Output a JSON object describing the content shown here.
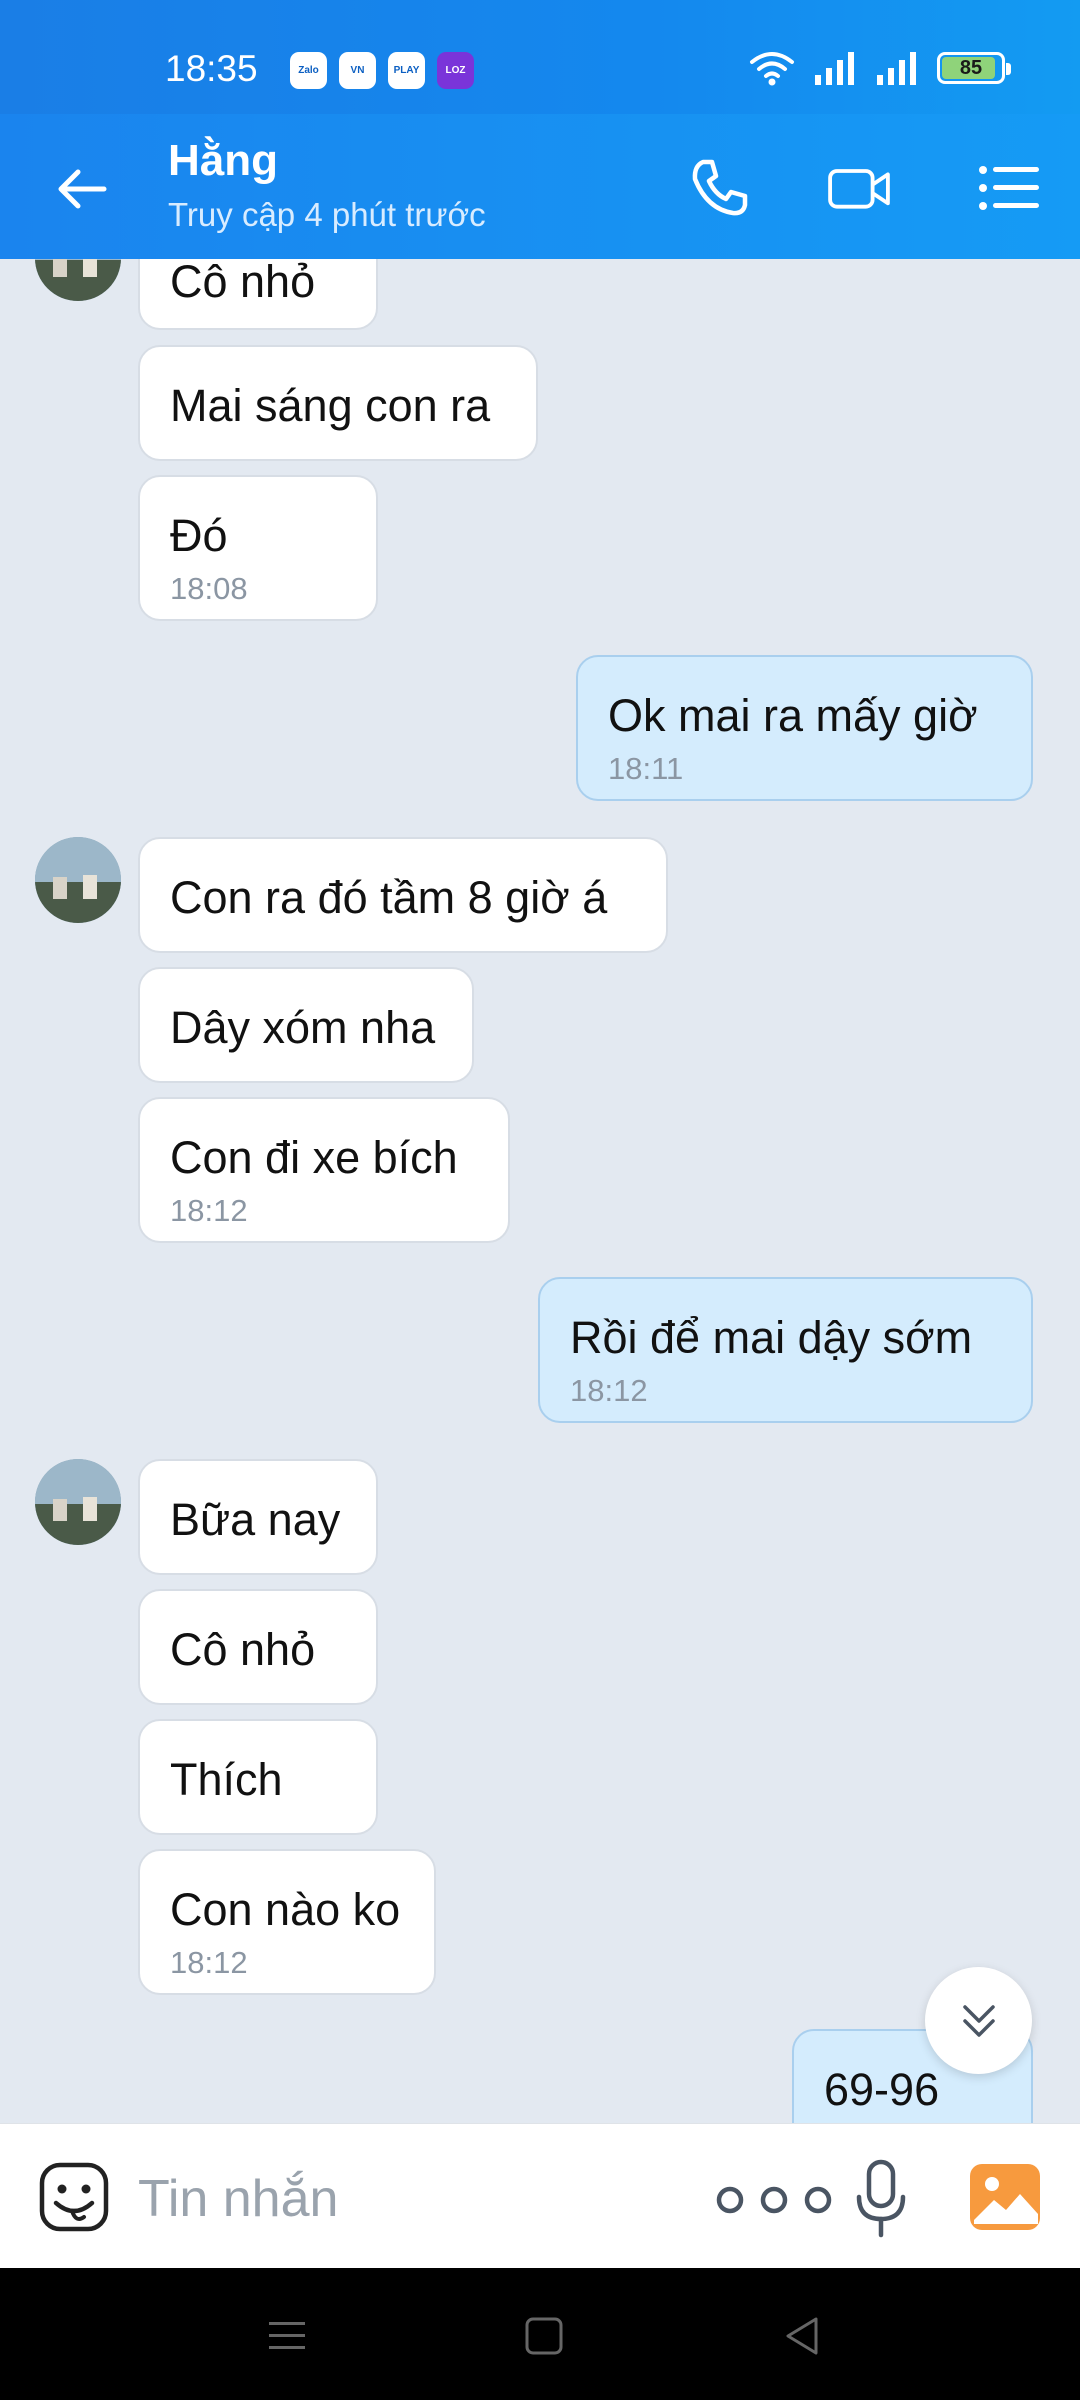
{
  "status_bar": {
    "time": "18:35",
    "apps": [
      "Zalo",
      "VN",
      "PLAY",
      "LOZ"
    ],
    "battery": "85"
  },
  "header": {
    "name": "Hằng",
    "status": "Truy cập 4 phút trước"
  },
  "messages": [
    {
      "text": "Cô nhỏ",
      "time": ""
    },
    {
      "text": "Mai sáng con ra",
      "time": ""
    },
    {
      "text": "Đó",
      "time": "18:08"
    },
    {
      "text": "Ok mai ra mấy giờ",
      "time": "18:11"
    },
    {
      "text": "Con ra đó tầm 8 giờ á",
      "time": ""
    },
    {
      "text": "Dây xóm nha",
      "time": ""
    },
    {
      "text": "Con đi xe bích",
      "time": "18:12"
    },
    {
      "text": "Rồi để mai dậy sớm",
      "time": "18:12"
    },
    {
      "text": "Bữa nay",
      "time": ""
    },
    {
      "text": "Cô nhỏ",
      "time": ""
    },
    {
      "text": "Thích",
      "time": ""
    },
    {
      "text": "Con nào ko",
      "time": "18:12"
    },
    {
      "text": "69-96",
      "time": ""
    }
  ],
  "composer": {
    "placeholder": "Tin nhắn"
  },
  "colors": {
    "header": "#1a84ee",
    "chat_bg": "#e3e9f1",
    "outgoing_bubble": "#d4ecfd",
    "incoming_bubble": "#ffffff"
  },
  "icons": {
    "back": "arrow-left-icon",
    "call": "phone-icon",
    "video": "video-camera-icon",
    "menu": "list-icon",
    "emoji": "sticker-face-icon",
    "more": "more-dots-icon",
    "mic": "microphone-icon",
    "image": "image-icon",
    "scroll": "double-chevron-down-icon"
  }
}
